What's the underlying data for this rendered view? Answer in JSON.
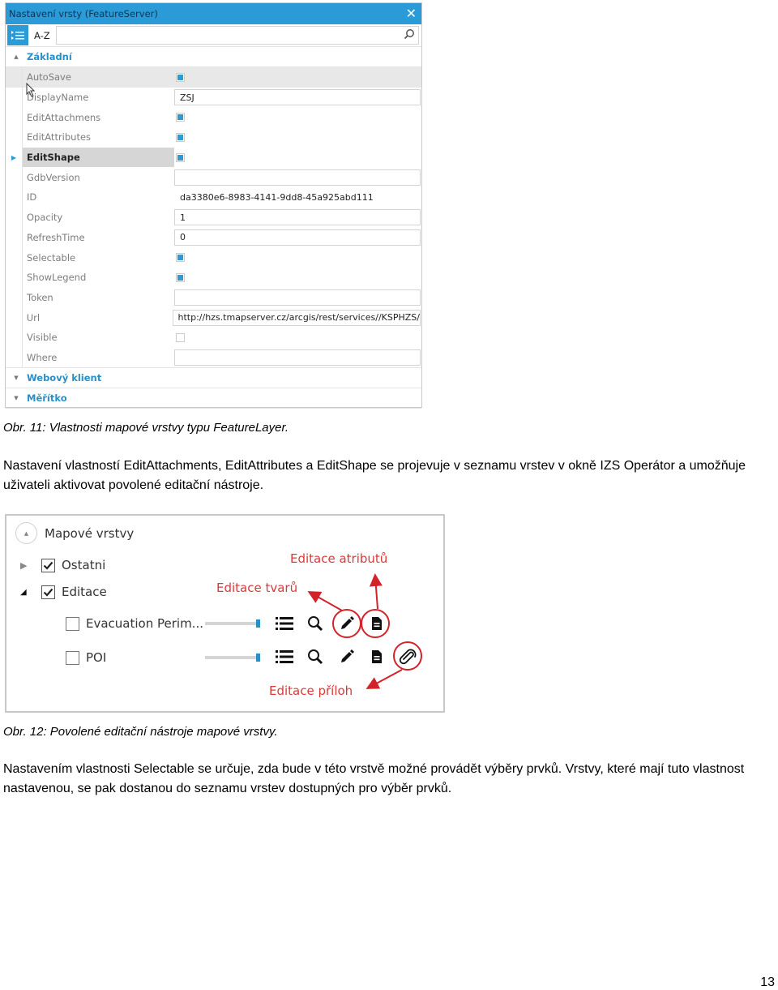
{
  "figure11": {
    "window_title": "Nastavení vrsty (FeatureServer)",
    "close_icon": "close-icon",
    "toolbar": {
      "categorized_icon": "categorized-list-icon",
      "sort_az_label": "A-Z",
      "search_value": "",
      "search_icon": "search-icon"
    },
    "groups": [
      {
        "label": "Základní",
        "expanded": true
      },
      {
        "label": "Webový klient",
        "expanded": false
      },
      {
        "label": "Měřítko",
        "expanded": false
      }
    ],
    "properties": [
      {
        "name": "AutoSave",
        "type": "checkbox",
        "checked": true,
        "state": "hover"
      },
      {
        "name": "DisplayName",
        "type": "text",
        "value": "ZSJ"
      },
      {
        "name": "EditAttachmens",
        "type": "checkbox",
        "checked": true
      },
      {
        "name": "EditAttributes",
        "type": "checkbox",
        "checked": true
      },
      {
        "name": "EditShape",
        "type": "checkbox",
        "checked": true,
        "state": "selected"
      },
      {
        "name": "GdbVersion",
        "type": "text",
        "value": ""
      },
      {
        "name": "ID",
        "type": "readonly",
        "value": "da3380e6-8983-4141-9dd8-45a925abd111"
      },
      {
        "name": "Opacity",
        "type": "text",
        "value": "1"
      },
      {
        "name": "RefreshTime",
        "type": "text",
        "value": "0"
      },
      {
        "name": "Selectable",
        "type": "checkbox",
        "checked": true
      },
      {
        "name": "ShowLegend",
        "type": "checkbox",
        "checked": true
      },
      {
        "name": "Token",
        "type": "text",
        "value": ""
      },
      {
        "name": "Url",
        "type": "text",
        "value": "http://hzs.tmapserver.cz/arcgis/rest/services//KSPHZS/"
      },
      {
        "name": "Visible",
        "type": "checkbox",
        "checked": false
      },
      {
        "name": "Where",
        "type": "text",
        "value": ""
      }
    ],
    "caption": "Obr. 11: Vlastnosti mapové vrstvy typu FeatureLayer."
  },
  "paragraph1": "Nastavení vlastností EditAttachments, EditAttributes a EditShape se projevuje v seznamu vrstev v okně IZS Operátor a umožňuje uživateli aktivovat povolené editační nástroje.",
  "figure12": {
    "panel_title": "Mapové vrstvy",
    "layers": [
      {
        "label": "Ostatni",
        "checked": true,
        "expanded": false
      },
      {
        "label": "Editace",
        "checked": true,
        "expanded": true
      },
      {
        "label": "Evacuation Perim...",
        "checked": false,
        "opacity": 1.0,
        "tools": [
          "legend-icon",
          "zoom-icon",
          "edit-shape-icon",
          "edit-attributes-icon"
        ]
      },
      {
        "label": "POI",
        "checked": false,
        "opacity": 1.0,
        "tools": [
          "legend-icon",
          "zoom-icon",
          "edit-shape-icon",
          "edit-attributes-icon",
          "attachment-icon"
        ]
      }
    ],
    "annotations": {
      "shape": "Editace tvarů",
      "attributes": "Editace atributů",
      "attachments": "Editace příloh"
    },
    "annotation_color": "#d93a3a",
    "caption": "Obr. 12: Povolené editační nástroje mapové vrstvy."
  },
  "paragraph2": "Nastavením vlastnosti Selectable se určuje, zda bude v této vrstvě možné provádět výběry prvků. Vrstvy, které mají tuto vlastnost nastavenou, se pak dostanou do seznamu vrstev dostupných pro výběr prvků.",
  "page_number": "13",
  "colors": {
    "accent": "#2a9bd6",
    "group_header": "#2a8fc5"
  }
}
